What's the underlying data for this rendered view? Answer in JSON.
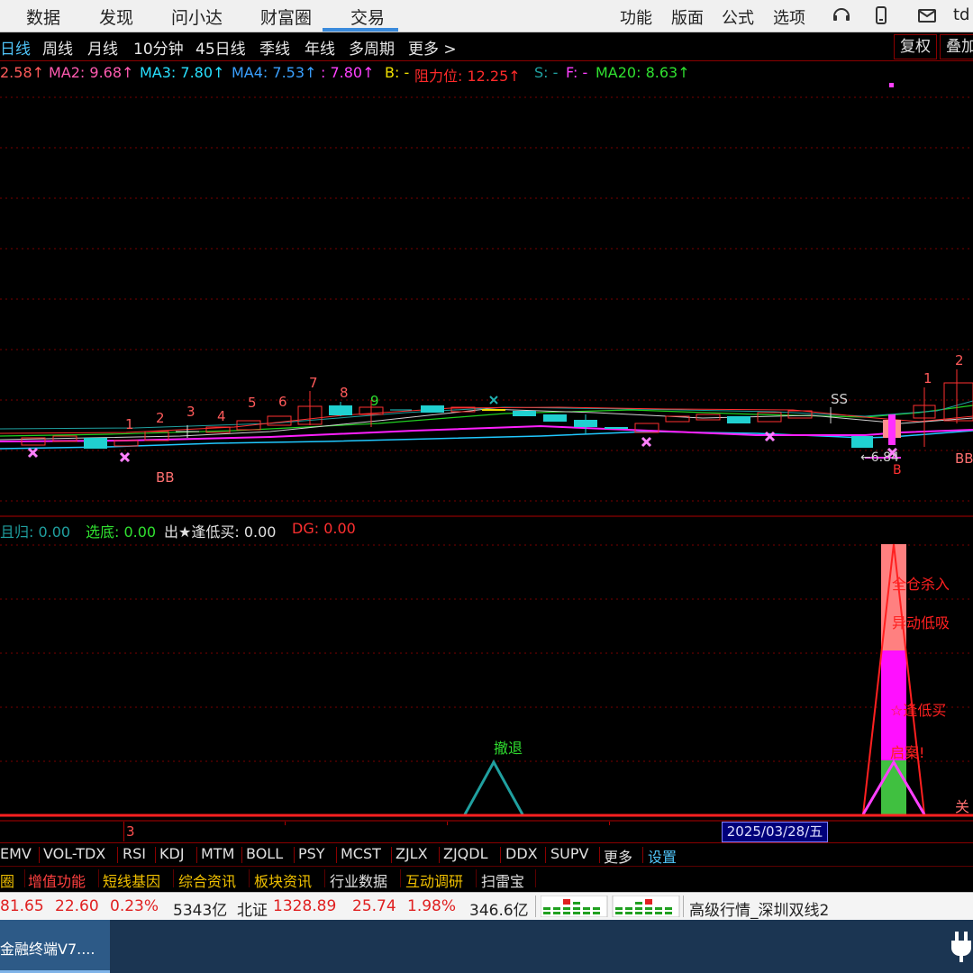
{
  "topbar": {
    "menu": [
      "数据",
      "发现",
      "问小达",
      "财富圈",
      "交易"
    ],
    "right_menu": [
      "功能",
      "版面",
      "公式",
      "选项"
    ],
    "brand_fragment": "td"
  },
  "periods": [
    "日线",
    "周线",
    "月线",
    "10分钟",
    "45日线",
    "季线",
    "年线",
    "多周期",
    "更多 >"
  ],
  "period_buttons": [
    "复权",
    "叠加"
  ],
  "indicators": {
    "ma1": "2.58↑",
    "ma2": "MA2: 9.68↑",
    "ma3": "MA3: 7.80↑",
    "ma4": "MA4: 7.53↑",
    "ma5": ": 7.80↑",
    "b": "B: -",
    "resistance": "阻力位: 12.25↑",
    "s": "S: -",
    "f": "F: -",
    "ma20": "MA20: 8.63↑"
  },
  "chart_labels": {
    "counts": [
      "1",
      "2",
      "3",
      "4",
      "5",
      "6",
      "7",
      "8",
      "9",
      "1",
      "2"
    ],
    "bb1": "BB",
    "bb2": "BB",
    "ss": "SS",
    "low_price": "←6.84",
    "b_mark": "B"
  },
  "sub_indicators": {
    "a": "且归: 0.00",
    "b": "选底: 0.00",
    "c": "出★逢低买: 0.00",
    "d": "DG: 0.00"
  },
  "sub_labels": {
    "retreat": "撤退",
    "full_position": "全仓杀入",
    "abnormal_low": "异动低吸",
    "buy_low": "☆逢低买",
    "signal": "启案!",
    "close": "关"
  },
  "axis": {
    "marker": "3",
    "date": "2025/03/28/五"
  },
  "indicator_tabs": [
    "EMV",
    "VOL-TDX",
    "RSI",
    "KDJ",
    "MTM",
    "BOLL",
    "PSY",
    "MCST",
    "ZJLX",
    "ZJQDL",
    "DDX",
    "SUPV",
    "更多",
    "设置"
  ],
  "feature_tabs": [
    "圈",
    "增值功能",
    "短线基因",
    "综合资讯",
    "板块资讯",
    "行业数据",
    "互动调研",
    "扫雷宝"
  ],
  "ticker": {
    "v1": "81.65",
    "v2": "22.60",
    "v3": "0.23%",
    "v4": "5343亿",
    "name": "北证",
    "v5": "1328.89",
    "v6": "25.74",
    "v7": "1.98%",
    "v8": "346.6亿",
    "feed": "高级行情_深圳双线2"
  },
  "taskbar": {
    "app_title": "金融终端V7...."
  },
  "colors": {
    "up": "#ff3b3b",
    "down": "#00d2d2",
    "grid": "#8b0000",
    "magenta": "#ff00ff"
  }
}
